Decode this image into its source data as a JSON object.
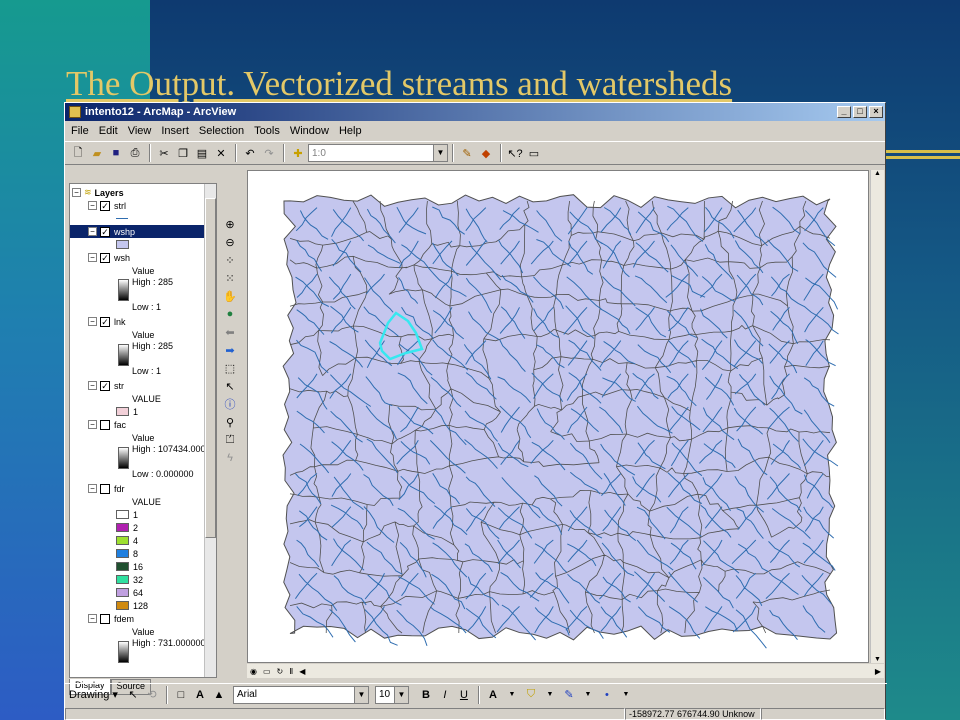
{
  "slide": {
    "title": "The Output. Vectorized streams and watersheds",
    "accent": "#e3c867"
  },
  "window": {
    "title": "intento12 - ArcMap - ArcView",
    "menu": [
      "File",
      "Edit",
      "View",
      "Insert",
      "Selection",
      "Tools",
      "Window",
      "Help"
    ],
    "scale_value": "1:0"
  },
  "toc": {
    "root": "Layers",
    "layers": [
      {
        "name": "strl"
      },
      {
        "name": "wshp"
      },
      {
        "name": "wsh",
        "field": "Value",
        "high": "High : 285",
        "low": "Low : 1"
      },
      {
        "name": "lnk",
        "field": "Value",
        "high": "High : 285",
        "low": "Low : 1"
      },
      {
        "name": "str",
        "field": "VALUE",
        "value": "1"
      },
      {
        "name": "fac",
        "field": "Value",
        "high": "High : 107434.000",
        "low": "Low : 0.000000"
      },
      {
        "name": "fdr",
        "field": "VALUE",
        "classes": [
          "1",
          "2",
          "4",
          "8",
          "16",
          "32",
          "64",
          "128"
        ],
        "colors": [
          "#ffffff",
          "#b020b0",
          "#9ee030",
          "#2080e0",
          "#205030",
          "#30e0a0",
          "#c0a0e0",
          "#d08a10"
        ]
      },
      {
        "name": "fdem",
        "field": "Value",
        "high": "High : 731.000000"
      }
    ],
    "tabs": [
      "Display",
      "Source"
    ]
  },
  "drawing": {
    "menu_label": "Drawing",
    "font": "Arial",
    "font_size": "10",
    "bold": "B",
    "italic": "I",
    "underline": "U"
  },
  "status": {
    "coords": "-158972.77  676744.90 Unknow"
  },
  "map": {
    "fill_color": "#c4c6ee",
    "boundary_color": "#505050",
    "stream_color": "#2f6db0",
    "selection_color": "#36e8f0"
  }
}
